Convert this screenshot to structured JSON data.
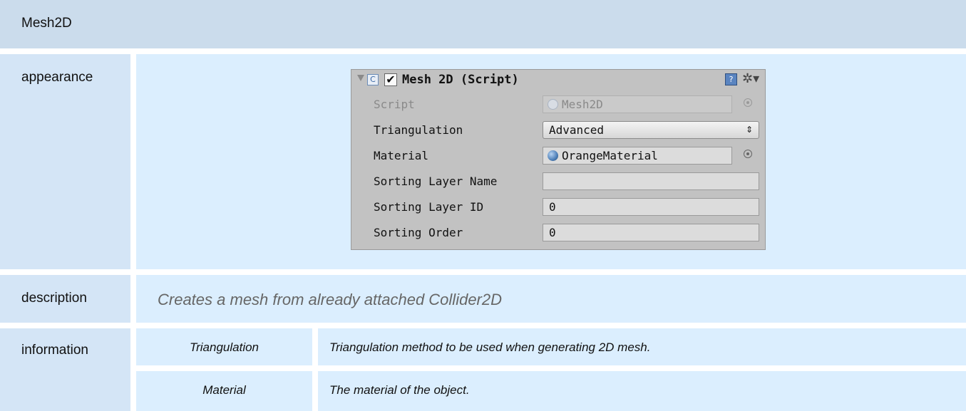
{
  "title": "Mesh2D",
  "appearance": {
    "label": "appearance",
    "inspector": {
      "component_title": "Mesh 2D (Script)",
      "enabled_mark": "✔",
      "help_glyph": "?",
      "gear_glyph": "✲▾",
      "fields": {
        "script": {
          "label": "Script",
          "value": "Mesh2D"
        },
        "triangulation": {
          "label": "Triangulation",
          "value": "Advanced",
          "arrow": "⇕"
        },
        "material": {
          "label": "Material",
          "value": "OrangeMaterial"
        },
        "sorting_layer_name": {
          "label": "Sorting Layer Name",
          "value": ""
        },
        "sorting_layer_id": {
          "label": "Sorting Layer ID",
          "value": "0"
        },
        "sorting_order": {
          "label": "Sorting Order",
          "value": "0"
        }
      }
    }
  },
  "description": {
    "label": "description",
    "text": "Creates a mesh from already attached Collider2D"
  },
  "information": {
    "label": "information",
    "rows": [
      {
        "name": "Triangulation",
        "desc": "Triangulation method to be used when generating 2D mesh."
      },
      {
        "name": "Material",
        "desc": "The material of the object."
      }
    ]
  }
}
